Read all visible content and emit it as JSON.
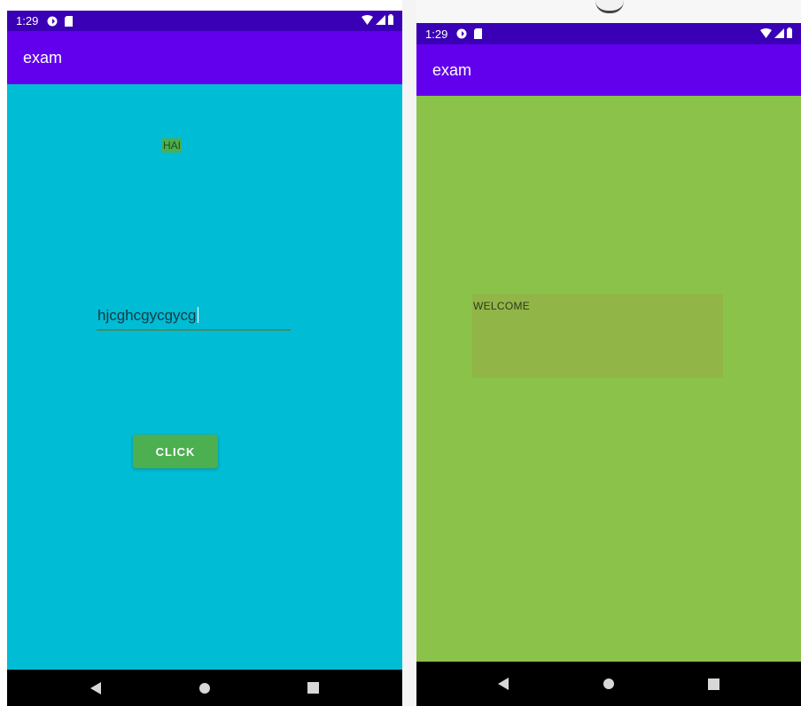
{
  "left_screen": {
    "status_bar": {
      "time": "1:29",
      "color": "#3a00b5"
    },
    "app_bar": {
      "title": "exam",
      "color": "#6200ee"
    },
    "content": {
      "background": "#00bcd4",
      "label_text": "HAI",
      "input_value": "hjcghcgycgycg",
      "button_label": "CLICK",
      "button_color": "#4caf50"
    },
    "nav_bar": {
      "items": [
        "back-icon",
        "home-icon",
        "recents-icon"
      ]
    }
  },
  "right_screen": {
    "status_bar": {
      "time": "1:29",
      "color": "#3a00b5"
    },
    "app_bar": {
      "title": "exam",
      "color": "#6200ee"
    },
    "content": {
      "background": "#8bc34a",
      "welcome_text": "WELCOME"
    },
    "nav_bar": {
      "items": [
        "back-icon",
        "home-icon",
        "recents-icon"
      ]
    }
  }
}
